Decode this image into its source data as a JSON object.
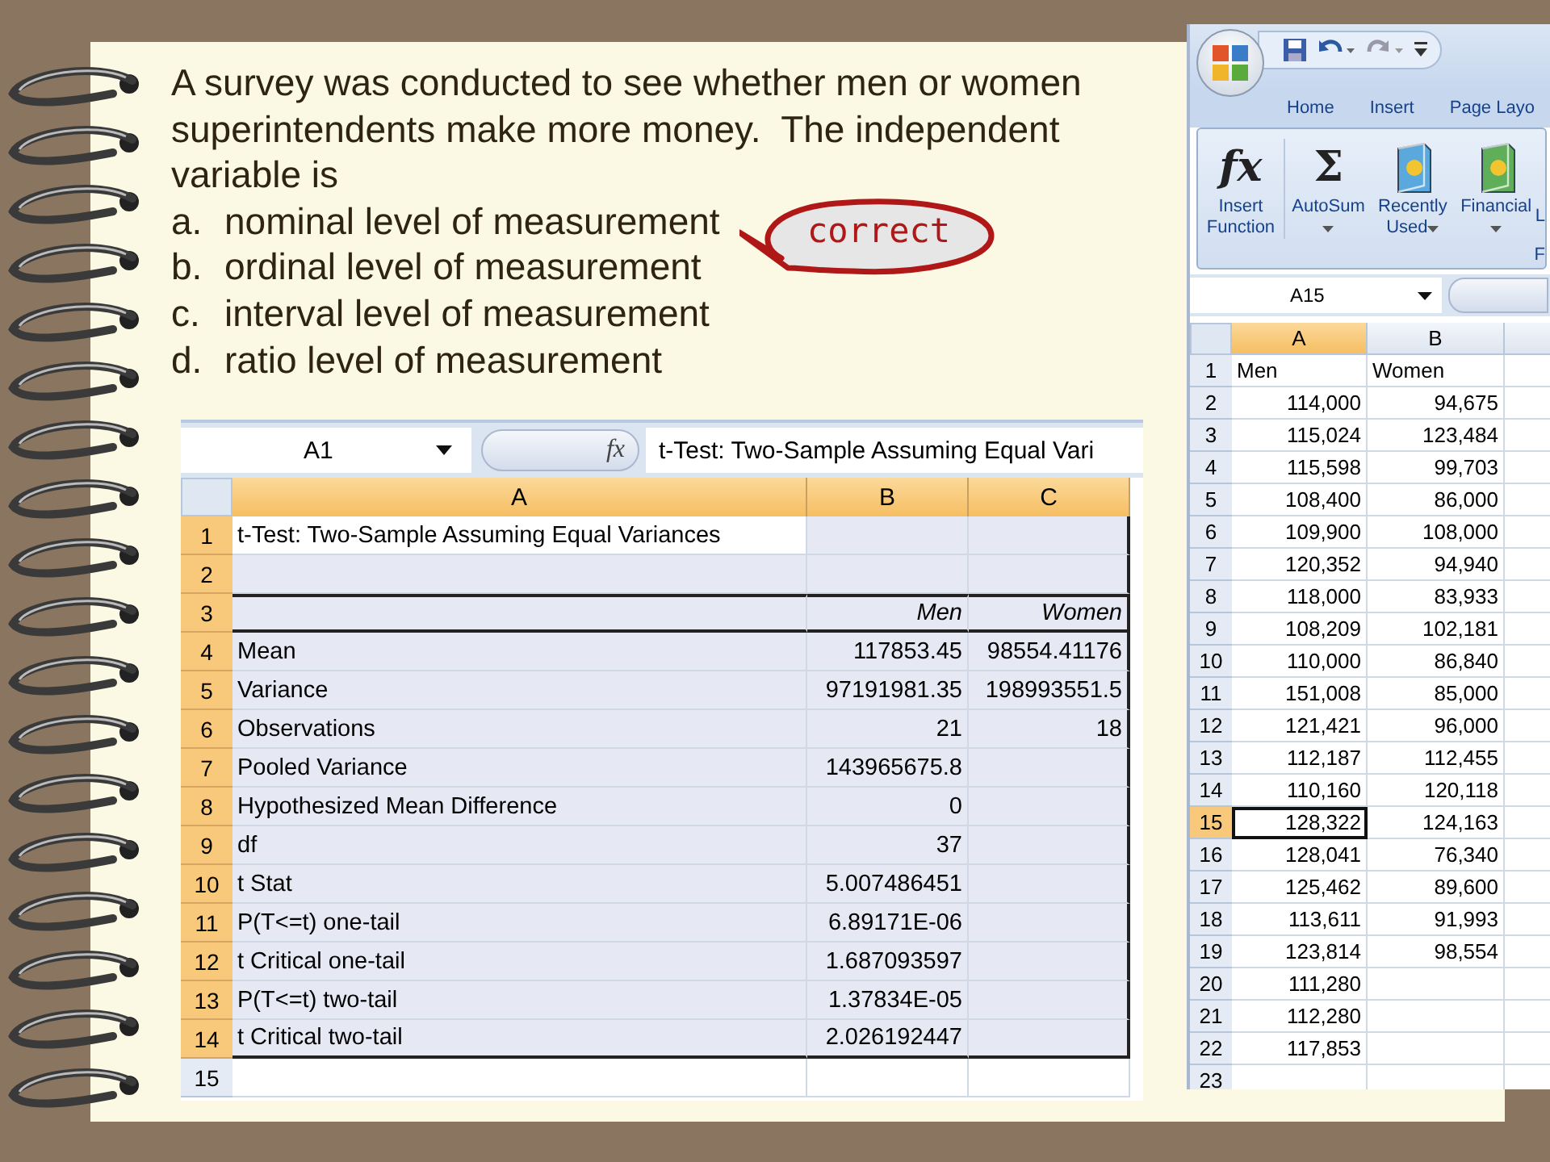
{
  "question": {
    "text": "A survey was conducted to see whether men or women superintendents make more money.  The independent variable is",
    "options": [
      {
        "letter": "a.",
        "text": "nominal level of measurement",
        "correct": true
      },
      {
        "letter": "b.",
        "text": "ordinal level of measurement",
        "correct": false
      },
      {
        "letter": "c.",
        "text": "interval level of measurement",
        "correct": false
      },
      {
        "letter": "d.",
        "text": "ratio level of measurement",
        "correct": false
      }
    ],
    "callout": "correct"
  },
  "output_sheet": {
    "name_box": "A1",
    "fx_glyph": "fx",
    "formula": "t-Test: Two-Sample Assuming Equal Vari",
    "columns": [
      "A",
      "B",
      "C"
    ],
    "rows": [
      {
        "number": "1",
        "kind": "title",
        "selected": true,
        "cells": [
          "t-Test: Two-Sample Assuming Equal Variances"
        ]
      },
      {
        "number": "2",
        "kind": "blank",
        "selected": true,
        "cells": []
      },
      {
        "number": "3",
        "kind": "header",
        "selected": true,
        "cells": [
          "",
          "Men",
          "Women"
        ]
      },
      {
        "number": "4",
        "kind": "data",
        "selected": true,
        "cells": [
          "Mean",
          "117853.45",
          "98554.41176"
        ]
      },
      {
        "number": "5",
        "kind": "data",
        "selected": true,
        "cells": [
          "Variance",
          "97191981.35",
          "198993551.5"
        ]
      },
      {
        "number": "6",
        "kind": "data",
        "selected": true,
        "cells": [
          "Observations",
          "21",
          "18"
        ]
      },
      {
        "number": "7",
        "kind": "data",
        "selected": true,
        "cells": [
          "Pooled Variance",
          "143965675.8"
        ]
      },
      {
        "number": "8",
        "kind": "data",
        "selected": true,
        "cells": [
          "Hypothesized Mean Difference",
          "0"
        ]
      },
      {
        "number": "9",
        "kind": "data",
        "selected": true,
        "cells": [
          "df",
          "37"
        ]
      },
      {
        "number": "10",
        "kind": "data",
        "selected": true,
        "cells": [
          "t Stat",
          "5.007486451"
        ]
      },
      {
        "number": "11",
        "kind": "data",
        "selected": true,
        "cells": [
          "P(T<=t) one-tail",
          "6.89171E-06"
        ]
      },
      {
        "number": "12",
        "kind": "data",
        "selected": true,
        "cells": [
          "t Critical one-tail",
          "1.687093597"
        ]
      },
      {
        "number": "13",
        "kind": "data",
        "selected": true,
        "cells": [
          "P(T<=t) two-tail",
          "1.37834E-05"
        ]
      },
      {
        "number": "14",
        "kind": "data",
        "selected": true,
        "cells": [
          "t Critical two-tail",
          "2.026192447"
        ]
      },
      {
        "number": "15",
        "kind": "blank",
        "selected": false,
        "cells": []
      }
    ]
  },
  "data_sheet": {
    "tabs": [
      "Home",
      "Insert",
      "Page Layo"
    ],
    "ribbon": [
      {
        "kind": "glyph",
        "glyph": "fx",
        "label": "Insert Function",
        "dropdown": false
      },
      {
        "kind": "glyph",
        "glyph": "Σ",
        "label": "AutoSum",
        "dropdown": true
      },
      {
        "kind": "book",
        "color": "#5aa8dc",
        "label": "Recently Used",
        "dropdown": true
      },
      {
        "kind": "book",
        "color": "#5fae5a",
        "label": "Financial",
        "dropdown": true
      },
      {
        "kind": "cut",
        "label": "L"
      }
    ],
    "group_label": "F",
    "name_box": "A15",
    "columns": [
      {
        "label": "A",
        "selected": true
      },
      {
        "label": "B",
        "selected": false
      }
    ],
    "rows": [
      {
        "number": "1",
        "kind": "label",
        "selected": false,
        "cells": [
          "Men",
          "Women"
        ]
      },
      {
        "number": "2",
        "kind": "data",
        "selected": false,
        "cells": [
          "114,000",
          "94,675"
        ]
      },
      {
        "number": "3",
        "kind": "data",
        "selected": false,
        "cells": [
          "115,024",
          "123,484"
        ]
      },
      {
        "number": "4",
        "kind": "data",
        "selected": false,
        "cells": [
          "115,598",
          "99,703"
        ]
      },
      {
        "number": "5",
        "kind": "data",
        "selected": false,
        "cells": [
          "108,400",
          "86,000"
        ]
      },
      {
        "number": "6",
        "kind": "data",
        "selected": false,
        "cells": [
          "109,900",
          "108,000"
        ]
      },
      {
        "number": "7",
        "kind": "data",
        "selected": false,
        "cells": [
          "120,352",
          "94,940"
        ]
      },
      {
        "number": "8",
        "kind": "data",
        "selected": false,
        "cells": [
          "118,000",
          "83,933"
        ]
      },
      {
        "number": "9",
        "kind": "data",
        "selected": false,
        "cells": [
          "108,209",
          "102,181"
        ]
      },
      {
        "number": "10",
        "kind": "data",
        "selected": false,
        "cells": [
          "110,000",
          "86,840"
        ]
      },
      {
        "number": "11",
        "kind": "data",
        "selected": false,
        "cells": [
          "151,008",
          "85,000"
        ]
      },
      {
        "number": "12",
        "kind": "data",
        "selected": false,
        "cells": [
          "121,421",
          "96,000"
        ]
      },
      {
        "number": "13",
        "kind": "data",
        "selected": false,
        "cells": [
          "112,187",
          "112,455"
        ]
      },
      {
        "number": "14",
        "kind": "data",
        "selected": false,
        "cells": [
          "110,160",
          "120,118"
        ]
      },
      {
        "number": "15",
        "kind": "data",
        "selected": true,
        "cells": [
          "128,322",
          "124,163"
        ]
      },
      {
        "number": "16",
        "kind": "data",
        "selected": false,
        "cells": [
          "128,041",
          "76,340"
        ]
      },
      {
        "number": "17",
        "kind": "data",
        "selected": false,
        "cells": [
          "125,462",
          "89,600"
        ]
      },
      {
        "number": "18",
        "kind": "data",
        "selected": false,
        "cells": [
          "113,611",
          "91,993"
        ]
      },
      {
        "number": "19",
        "kind": "data",
        "selected": false,
        "cells": [
          "123,814",
          "98,554"
        ]
      },
      {
        "number": "20",
        "kind": "data",
        "selected": false,
        "cells": [
          "111,280"
        ]
      },
      {
        "number": "21",
        "kind": "data",
        "selected": false,
        "cells": [
          "112,280"
        ]
      },
      {
        "number": "22",
        "kind": "data",
        "selected": false,
        "cells": [
          "117,853"
        ]
      },
      {
        "number": "23",
        "kind": "data",
        "selected": false,
        "cells": []
      }
    ]
  }
}
